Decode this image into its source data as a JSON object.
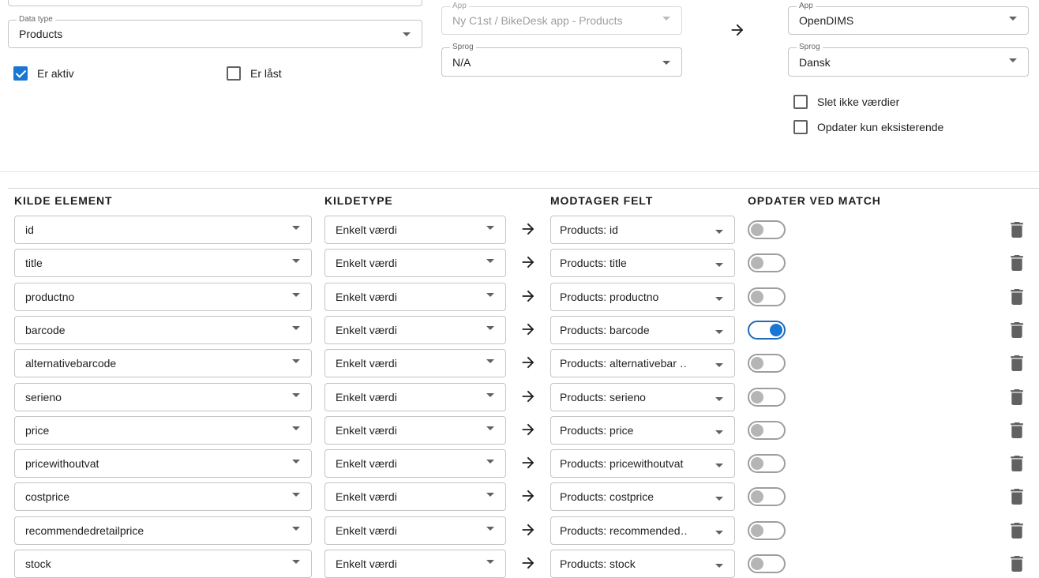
{
  "source": {
    "data_type_label": "Data type",
    "data_type_value": "Products",
    "er_aktiv_label": "Er aktiv",
    "er_aktiv_checked": true,
    "er_last_label": "Er låst",
    "er_last_checked": false
  },
  "middle": {
    "app_label": "App",
    "app_value": "Ny C1st / BikeDesk app - Products",
    "sprog_label": "Sprog",
    "sprog_value": "N/A",
    "arrow_icon": "arrow-right-icon"
  },
  "target": {
    "app_label": "App",
    "app_value": "OpenDIMS",
    "sprog_label": "Sprog",
    "sprog_value": "Dansk",
    "slet_label": "Slet ikke værdier",
    "slet_checked": false,
    "opdater_label": "Opdater kun eksisterende",
    "opdater_checked": false
  },
  "mapping": {
    "headers": {
      "kilde_element": "KILDE ELEMENT",
      "kildetype": "KILDETYPE",
      "modtager_felt": "MODTAGER FELT",
      "opdater_ved_match": "OPDATER VED MATCH"
    },
    "rows": [
      {
        "kilde": "id",
        "type": "Enkelt værdi",
        "modtager": "Products: id",
        "match": false
      },
      {
        "kilde": "title",
        "type": "Enkelt værdi",
        "modtager": "Products: title",
        "match": false
      },
      {
        "kilde": "productno",
        "type": "Enkelt værdi",
        "modtager": "Products: productno",
        "match": false
      },
      {
        "kilde": "barcode",
        "type": "Enkelt værdi",
        "modtager": "Products: barcode",
        "match": true
      },
      {
        "kilde": "alternativebarcode",
        "type": "Enkelt værdi",
        "modtager": "Products: alternativebar …",
        "match": false
      },
      {
        "kilde": "serieno",
        "type": "Enkelt værdi",
        "modtager": "Products: serieno",
        "match": false
      },
      {
        "kilde": "price",
        "type": "Enkelt værdi",
        "modtager": "Products: price",
        "match": false
      },
      {
        "kilde": "pricewithoutvat",
        "type": "Enkelt værdi",
        "modtager": "Products: pricewithoutvat",
        "match": false
      },
      {
        "kilde": "costprice",
        "type": "Enkelt værdi",
        "modtager": "Products: costprice",
        "match": false
      },
      {
        "kilde": "recommendedretailprice",
        "type": "Enkelt værdi",
        "modtager": "Products: recommended…",
        "match": false
      },
      {
        "kilde": "stock",
        "type": "Enkelt værdi",
        "modtager": "Products: stock",
        "match": false
      }
    ]
  },
  "colors": {
    "accent": "#1976d2",
    "toggle_off_knob": "#b5b5b5",
    "border": "#c4c4c4"
  }
}
